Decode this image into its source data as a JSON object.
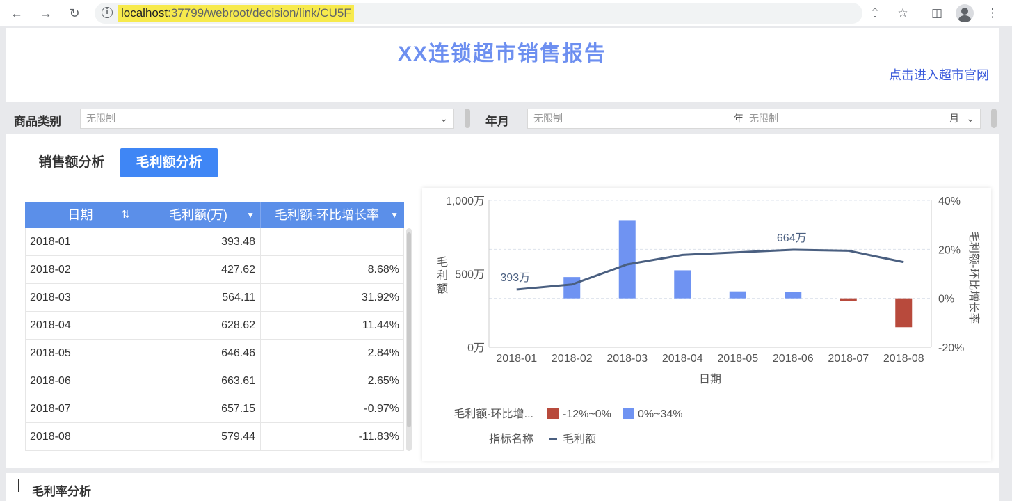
{
  "browser": {
    "url_host": "localhost",
    "url_rest": ":37799/webroot/decision/link/CU5F"
  },
  "header": {
    "title": "XX连锁超市销售报告",
    "link_text": "点击进入超市官网"
  },
  "filters": {
    "category_label": "商品类别",
    "category_placeholder": "无限制",
    "yearmonth_label": "年月",
    "year_placeholder": "无限制",
    "year_unit": "年",
    "month_placeholder": "无限制",
    "month_unit": "月"
  },
  "tabs": {
    "sales": "销售额分析",
    "profit": "毛利额分析"
  },
  "table": {
    "headers": [
      "日期",
      "毛利额(万)",
      "毛利额-环比增长率"
    ],
    "rows": [
      [
        "2018-01",
        "393.48",
        ""
      ],
      [
        "2018-02",
        "427.62",
        "8.68%"
      ],
      [
        "2018-03",
        "564.11",
        "31.92%"
      ],
      [
        "2018-04",
        "628.62",
        "11.44%"
      ],
      [
        "2018-05",
        "646.46",
        "2.84%"
      ],
      [
        "2018-06",
        "663.61",
        "2.65%"
      ],
      [
        "2018-07",
        "657.15",
        "-0.97%"
      ],
      [
        "2018-08",
        "579.44",
        "-11.83%"
      ]
    ]
  },
  "chart_data": {
    "type": "bar+line",
    "categories": [
      "2018-01",
      "2018-02",
      "2018-03",
      "2018-04",
      "2018-05",
      "2018-06",
      "2018-07",
      "2018-08"
    ],
    "xlabel": "日期",
    "ylabel_left": "毛利额",
    "ylabel_right": "毛利额-环比增长率",
    "left_ticks": [
      "1,000万",
      "500万",
      "0万"
    ],
    "right_ticks": [
      "40%",
      "20%",
      "0%",
      "-20%"
    ],
    "ylim_left": [
      0,
      1000
    ],
    "ylim_right": [
      -20,
      40
    ],
    "series": [
      {
        "name": "毛利额",
        "kind": "line",
        "values": [
          393.48,
          427.62,
          564.11,
          628.62,
          646.46,
          663.61,
          657.15,
          579.44
        ]
      },
      {
        "name": "毛利额-环比增长率",
        "kind": "bar",
        "values": [
          null,
          8.68,
          31.92,
          11.44,
          2.84,
          2.65,
          -0.97,
          -11.83
        ]
      }
    ],
    "annotations": [
      "393万",
      "664万"
    ],
    "legend": {
      "bar_title": "毛利额-环比增...",
      "bar_items": [
        {
          "label": "-12%~0%",
          "color": "#b84a3c"
        },
        {
          "label": "0%~34%",
          "color": "#6f93f2"
        }
      ],
      "line_title": "指标名称",
      "line_items": [
        {
          "label": "毛利额",
          "color": "#4a5f80"
        }
      ]
    }
  },
  "bottom": {
    "title": "毛利率分析"
  }
}
